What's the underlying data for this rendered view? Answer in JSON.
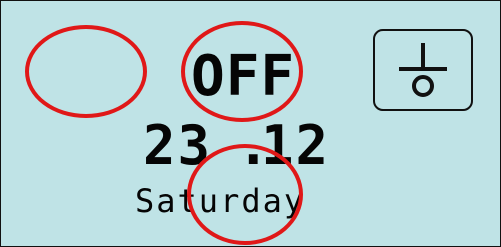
{
  "display": {
    "status": "OFF",
    "date_day": "23",
    "date_separator": ".",
    "date_month": "12",
    "weekday": "Saturday"
  },
  "controls": {
    "power_icon": "power-toggle-icon"
  },
  "colors": {
    "lcd_background": "#bfe3e6",
    "text": "#050505",
    "highlight": "#e01818"
  }
}
